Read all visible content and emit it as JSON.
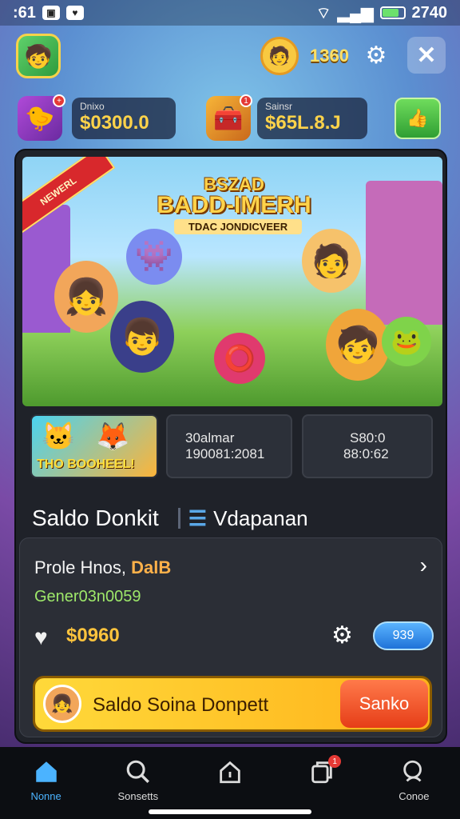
{
  "status_bar": {
    "left_text": ":61",
    "right_text": "2740"
  },
  "top_bar": {
    "coins": "1360"
  },
  "stats": {
    "left": {
      "label": "Dnixo",
      "value": "$0300.0"
    },
    "right": {
      "label": "Sainsr",
      "value": "$65L.8.J"
    },
    "left_badge": "+",
    "right_badge": "1"
  },
  "banner": {
    "ribbon": "NEWERL",
    "title_line1": "BSZAD",
    "title_line2": "BADD-IMERH",
    "subtitle": "TDAC JONDICVEER"
  },
  "cards": {
    "thumb_text": "THO BOOHEEL!",
    "card1": {
      "line1": "30almar",
      "line2": "190081:2081"
    },
    "card2": {
      "line1": "S80:0",
      "line2": "88:0:62"
    }
  },
  "tabs": {
    "left": "Saldo Donkit",
    "right": "Vdapanan"
  },
  "offer": {
    "title_prefix": "Prole Hnos,",
    "title_highlight": "DalB",
    "code": "Gener03n0059",
    "price": "$0960",
    "pill": "939"
  },
  "cta": {
    "label": "Saldo Soina Donpett",
    "button": "Sanko"
  },
  "nav": {
    "items": [
      {
        "label": "Nonne"
      },
      {
        "label": "Sonsetts"
      },
      {
        "label": ""
      },
      {
        "label": ""
      },
      {
        "label": "Conoe"
      }
    ],
    "badge": "1"
  },
  "colors": {
    "accent": "#ffc43d",
    "nav_active": "#4bb3ff",
    "panel": "#1f2229"
  }
}
